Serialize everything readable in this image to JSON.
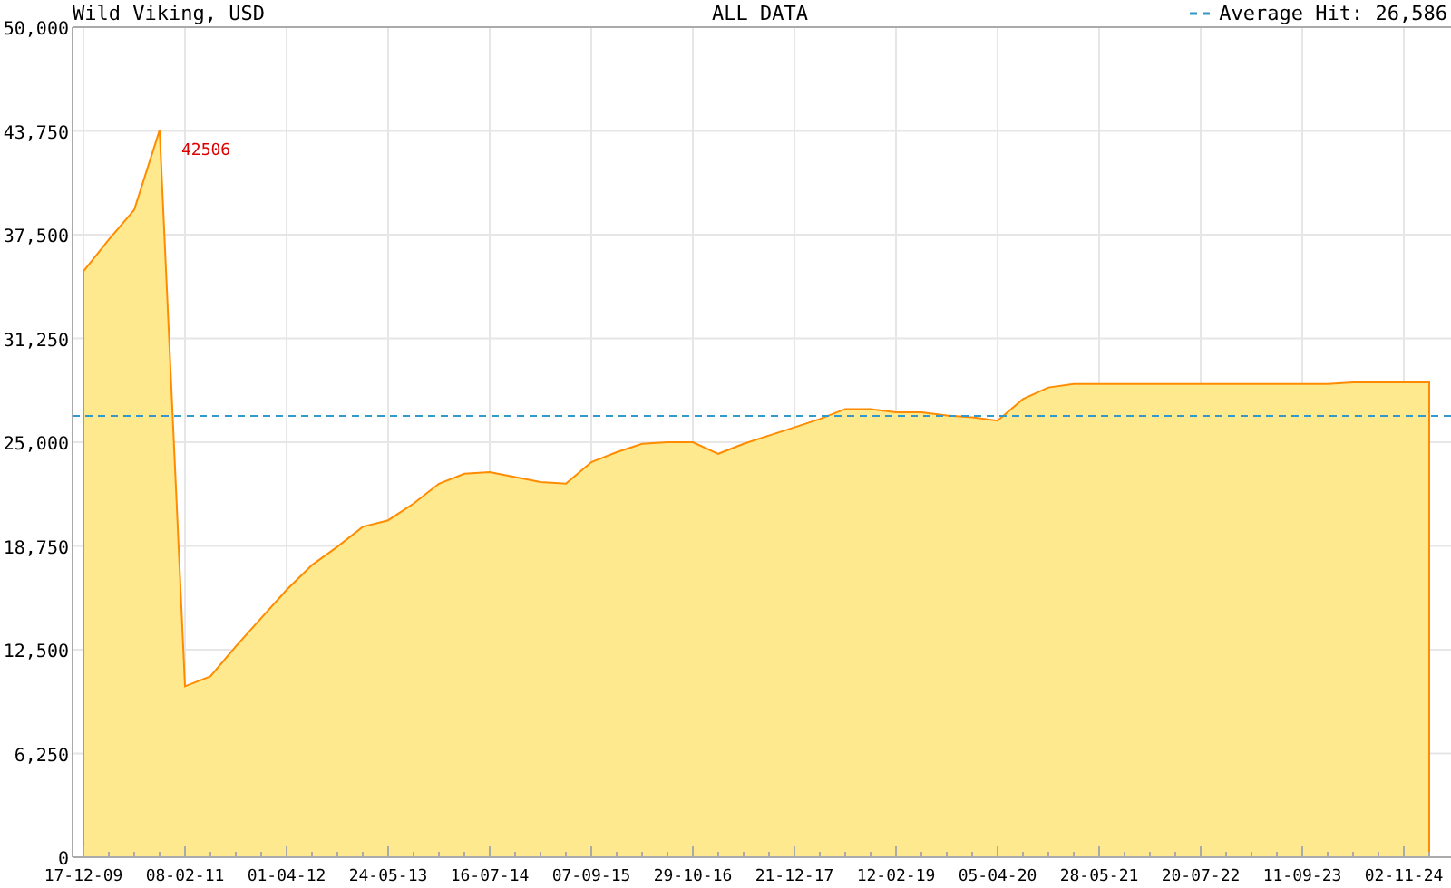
{
  "chart": {
    "header": {
      "subtitle": "ALL DATA"
    },
    "chart_data": {
      "type": "area",
      "title": "Wild Viking, USD",
      "categories": [
        "17-12-09",
        null,
        null,
        null,
        "08-02-11",
        null,
        null,
        null,
        "01-04-12",
        null,
        null,
        null,
        "24-05-13",
        null,
        null,
        null,
        "16-07-14",
        null,
        null,
        null,
        "07-09-15",
        null,
        null,
        null,
        "29-10-16",
        null,
        null,
        null,
        "21-12-17",
        null,
        null,
        null,
        "12-02-19",
        null,
        null,
        null,
        "05-04-20",
        null,
        null,
        null,
        "28-05-21",
        null,
        null,
        null,
        "20-07-22",
        null,
        null,
        null,
        "11-09-23",
        null,
        null,
        null,
        "02-11-24",
        null
      ],
      "series": [
        {
          "color": "#ff8c00",
          "values": [
            35300,
            37200,
            39000,
            43800,
            10300,
            10900,
            12700,
            14400,
            16100,
            17600,
            18700,
            19900,
            20300,
            21300,
            22500,
            23100,
            23200,
            22900,
            22600,
            22500,
            23800,
            24400,
            24900,
            25000,
            25000,
            24300,
            24900,
            25400,
            25900,
            26400,
            27000,
            27000,
            26800,
            26800,
            26600,
            26500,
            26300,
            27600,
            28300,
            28500,
            28500,
            28500,
            28500,
            28500,
            28500,
            28500,
            28500,
            28500,
            28500,
            28500,
            28600,
            28600,
            28600,
            28600
          ]
        }
      ],
      "ylim": [
        0,
        50000
      ],
      "grid": true,
      "yticks": [
        {
          "value": 0,
          "label": "0"
        },
        {
          "value": 6250,
          "label": "6,250"
        },
        {
          "value": 12500,
          "label": "12,500"
        },
        {
          "value": 18750,
          "label": "18,750"
        },
        {
          "value": 25000,
          "label": "25,000"
        },
        {
          "value": 31250,
          "label": "31,250"
        },
        {
          "value": 37500,
          "label": "37,500"
        },
        {
          "value": 43750,
          "label": "43,750"
        },
        {
          "value": 50000,
          "label": "50,000"
        }
      ],
      "ref_lines": [
        {
          "axis": "y",
          "value": 26586,
          "label": "Average Hit: 26,586"
        }
      ],
      "annotations": [
        "42506"
      ]
    }
  }
}
